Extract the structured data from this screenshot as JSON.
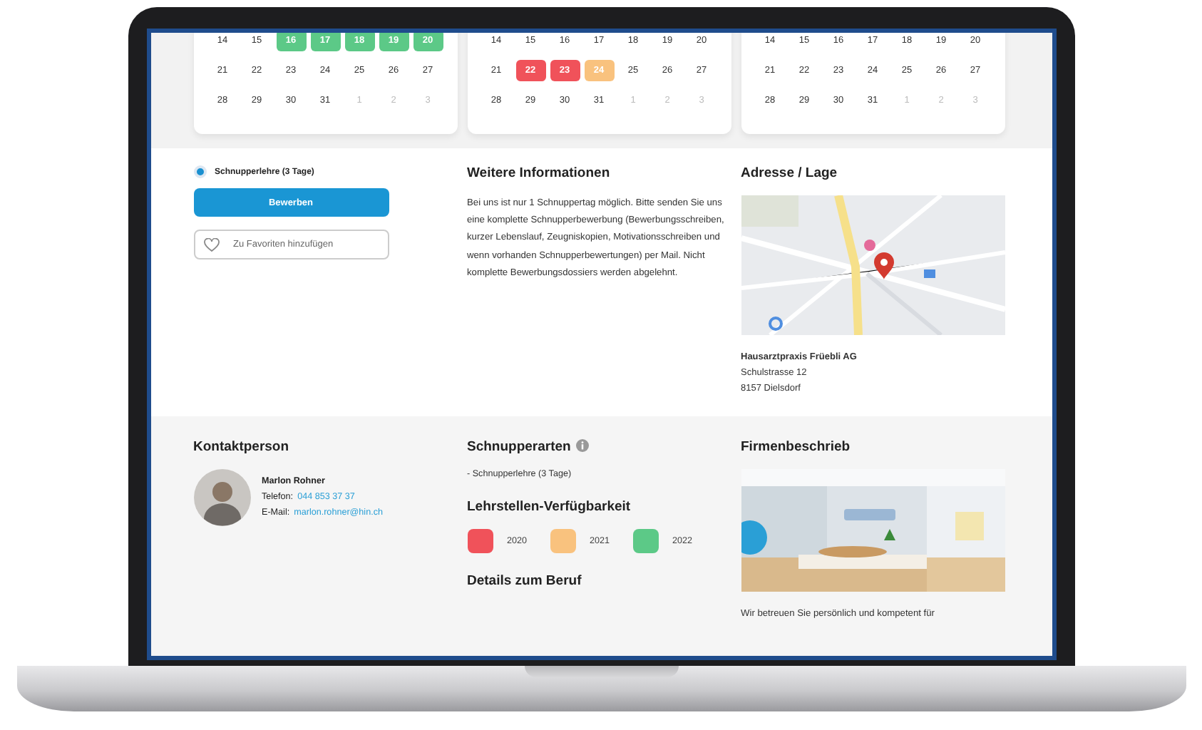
{
  "calendars": [
    {
      "weeks": [
        [
          {
            "day": "14",
            "muted": false
          },
          {
            "day": "15",
            "muted": false
          },
          {
            "day": "16",
            "muted": false,
            "color": "#5cc987"
          },
          {
            "day": "17",
            "muted": false,
            "color": "#5cc987"
          },
          {
            "day": "18",
            "muted": false,
            "color": "#5cc987"
          },
          {
            "day": "19",
            "muted": false,
            "color": "#5cc987"
          },
          {
            "day": "20",
            "muted": false,
            "color": "#5cc987"
          }
        ],
        [
          {
            "day": "21",
            "muted": false
          },
          {
            "day": "22",
            "muted": false
          },
          {
            "day": "23",
            "muted": false
          },
          {
            "day": "24",
            "muted": false
          },
          {
            "day": "25",
            "muted": false
          },
          {
            "day": "26",
            "muted": false
          },
          {
            "day": "27",
            "muted": false
          }
        ],
        [
          {
            "day": "28",
            "muted": false
          },
          {
            "day": "29",
            "muted": false
          },
          {
            "day": "30",
            "muted": false
          },
          {
            "day": "31",
            "muted": false
          },
          {
            "day": "1",
            "muted": true
          },
          {
            "day": "2",
            "muted": true
          },
          {
            "day": "3",
            "muted": true
          }
        ]
      ]
    },
    {
      "weeks": [
        [
          {
            "day": "14",
            "muted": false
          },
          {
            "day": "15",
            "muted": false
          },
          {
            "day": "16",
            "muted": false
          },
          {
            "day": "17",
            "muted": false
          },
          {
            "day": "18",
            "muted": false
          },
          {
            "day": "19",
            "muted": false
          },
          {
            "day": "20",
            "muted": false
          }
        ],
        [
          {
            "day": "21",
            "muted": false
          },
          {
            "day": "22",
            "muted": false,
            "color": "#f0525a"
          },
          {
            "day": "23",
            "muted": false,
            "color": "#f0525a"
          },
          {
            "day": "24",
            "muted": false,
            "color": "#f9c27e"
          },
          {
            "day": "25",
            "muted": false
          },
          {
            "day": "26",
            "muted": false
          },
          {
            "day": "27",
            "muted": false
          }
        ],
        [
          {
            "day": "28",
            "muted": false
          },
          {
            "day": "29",
            "muted": false
          },
          {
            "day": "30",
            "muted": false
          },
          {
            "day": "31",
            "muted": false
          },
          {
            "day": "1",
            "muted": true
          },
          {
            "day": "2",
            "muted": true
          },
          {
            "day": "3",
            "muted": true
          }
        ]
      ]
    },
    {
      "weeks": [
        [
          {
            "day": "14",
            "muted": false
          },
          {
            "day": "15",
            "muted": false
          },
          {
            "day": "16",
            "muted": false
          },
          {
            "day": "17",
            "muted": false
          },
          {
            "day": "18",
            "muted": false
          },
          {
            "day": "19",
            "muted": false
          },
          {
            "day": "20",
            "muted": false
          }
        ],
        [
          {
            "day": "21",
            "muted": false
          },
          {
            "day": "22",
            "muted": false
          },
          {
            "day": "23",
            "muted": false
          },
          {
            "day": "24",
            "muted": false
          },
          {
            "day": "25",
            "muted": false
          },
          {
            "day": "26",
            "muted": false
          },
          {
            "day": "27",
            "muted": false
          }
        ],
        [
          {
            "day": "28",
            "muted": false
          },
          {
            "day": "29",
            "muted": false
          },
          {
            "day": "30",
            "muted": false
          },
          {
            "day": "31",
            "muted": false
          },
          {
            "day": "1",
            "muted": true
          },
          {
            "day": "2",
            "muted": true
          },
          {
            "day": "3",
            "muted": true
          }
        ]
      ]
    }
  ],
  "application": {
    "option": {
      "label": "Schnupperlehre (3 Tage)",
      "selected": true
    },
    "apply_button": "Bewerben",
    "favorite_button": "Zu Favoriten hinzufügen"
  },
  "info": {
    "title": "Weitere Informationen",
    "text": "Bei uns ist nur 1 Schnuppertag möglich. Bitte senden Sie uns eine komplette Schnupperbewerbung (Bewerbungsschreiben, kurzer Lebenslauf, Zeugniskopien, Motivationsschreiben und wenn vorhanden Schnupperbewertungen) per Mail. Nicht komplette Bewerbungsdossiers werden abgelehnt."
  },
  "address": {
    "title": "Adresse / Lage",
    "name": "Hausarztpraxis Früebli AG",
    "street": "Schulstrasse 12",
    "city": "8157 Dielsdorf"
  },
  "contact": {
    "title": "Kontaktperson",
    "name": "Marlon Rohner",
    "phone_label": "Telefon:",
    "phone": "044 853 37 37",
    "email_label": "E-Mail:",
    "email": "marlon.rohner@hin.ch"
  },
  "trial_types": {
    "title": "Schnupperarten",
    "items": [
      "- Schnupperlehre (3 Tage)"
    ]
  },
  "availability": {
    "title": "Lehrstellen-Verfügbarkeit",
    "legend": [
      {
        "year": "2020",
        "color": "#f0525a"
      },
      {
        "year": "2021",
        "color": "#f9c27e"
      },
      {
        "year": "2022",
        "color": "#5cc987"
      }
    ]
  },
  "details": {
    "title": "Details zum Beruf"
  },
  "company": {
    "title": "Firmenbeschrieb",
    "text": "Wir betreuen Sie persönlich und kompetent für"
  }
}
